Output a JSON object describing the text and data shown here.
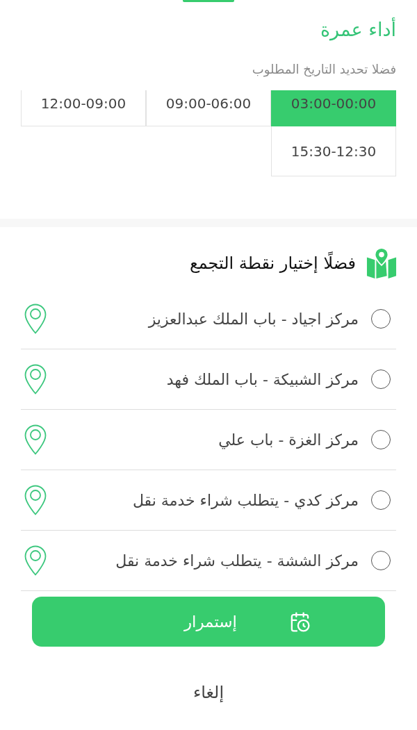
{
  "page": {
    "title": "أداء عمرة",
    "subtitle": "فضلا تحديد التاريخ المطلوب"
  },
  "time_slots": [
    {
      "label": "03:00-00:00",
      "selected": true
    },
    {
      "label": "09:00-06:00",
      "selected": false
    },
    {
      "label": "12:00-09:00",
      "selected": false
    },
    {
      "label": "15:30-12:30",
      "selected": false
    }
  ],
  "meeting_point": {
    "heading": "فضلًا إختيار نقطة التجمع",
    "options": [
      {
        "label": "مركز اجياد - باب الملك عبدالعزيز",
        "selected": false
      },
      {
        "label": "مركز الشبيكة - باب الملك فهد",
        "selected": false
      },
      {
        "label": "مركز الغزة - باب علي",
        "selected": false
      },
      {
        "label": "مركز كدي - يتطلب شراء خدمة نقل",
        "selected": false
      },
      {
        "label": "مركز الششة - يتطلب شراء خدمة نقل",
        "selected": false
      }
    ]
  },
  "buttons": {
    "continue": "إستمرار",
    "cancel": "إلغاء"
  }
}
